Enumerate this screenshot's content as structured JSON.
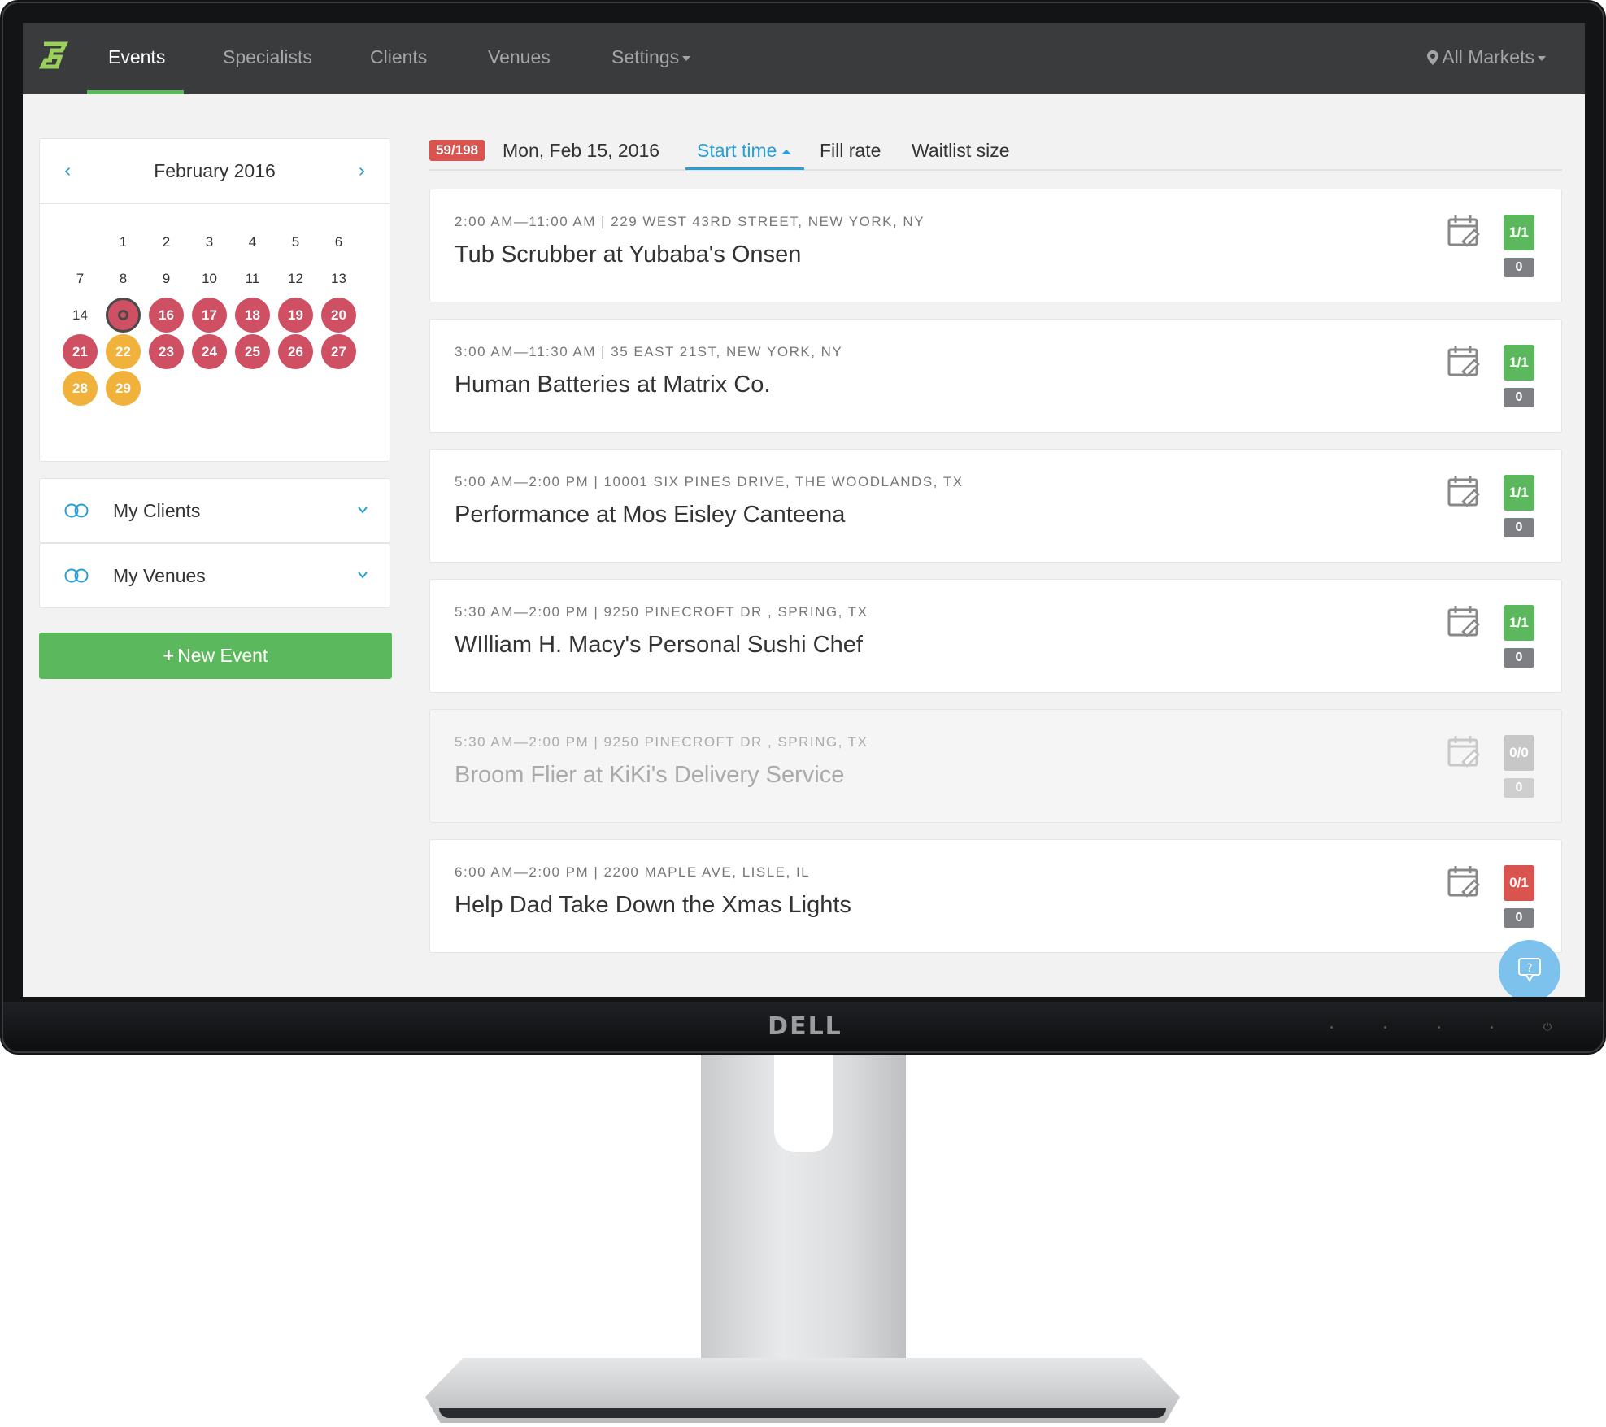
{
  "nav": {
    "items": [
      {
        "label": "Events"
      },
      {
        "label": "Specialists"
      },
      {
        "label": "Clients"
      },
      {
        "label": "Venues"
      },
      {
        "label": "Settings"
      }
    ],
    "markets_label": "All Markets"
  },
  "calendar": {
    "title": "February 2016",
    "today": 15,
    "days": [
      {
        "n": "1",
        "s": "plain"
      },
      {
        "n": "2",
        "s": "plain"
      },
      {
        "n": "3",
        "s": "plain"
      },
      {
        "n": "4",
        "s": "plain"
      },
      {
        "n": "5",
        "s": "plain"
      },
      {
        "n": "6",
        "s": "plain"
      },
      {
        "n": "7",
        "s": "plain"
      },
      {
        "n": "8",
        "s": "plain"
      },
      {
        "n": "9",
        "s": "plain"
      },
      {
        "n": "10",
        "s": "plain"
      },
      {
        "n": "11",
        "s": "plain"
      },
      {
        "n": "12",
        "s": "plain"
      },
      {
        "n": "13",
        "s": "plain"
      },
      {
        "n": "14",
        "s": "plain"
      },
      {
        "n": "15",
        "s": "today"
      },
      {
        "n": "16",
        "s": "red"
      },
      {
        "n": "17",
        "s": "red"
      },
      {
        "n": "18",
        "s": "red"
      },
      {
        "n": "19",
        "s": "red"
      },
      {
        "n": "20",
        "s": "red"
      },
      {
        "n": "21",
        "s": "red"
      },
      {
        "n": "22",
        "s": "orange"
      },
      {
        "n": "23",
        "s": "red"
      },
      {
        "n": "24",
        "s": "red"
      },
      {
        "n": "25",
        "s": "red"
      },
      {
        "n": "26",
        "s": "red"
      },
      {
        "n": "27",
        "s": "red"
      },
      {
        "n": "28",
        "s": "orange"
      },
      {
        "n": "29",
        "s": "orange"
      }
    ],
    "colors": {
      "booked": "#cf4f63",
      "partial": "#f0b23a"
    }
  },
  "filters": {
    "clients_label": "My Clients",
    "venues_label": "My Venues"
  },
  "new_event_label": "New Event",
  "list": {
    "count_badge": "59/198",
    "date": "Mon, Feb 15, 2016",
    "sort_tabs": [
      "Start time",
      "Fill rate",
      "Waitlist size"
    ]
  },
  "events": [
    {
      "meta": "2:00 AM—11:00 AM | 229 WEST 43RD STREET, NEW YORK, NY",
      "title": "Tub Scrubber at Yubaba's Onsen",
      "fill": "1/1",
      "waitlist": "0",
      "status": "green"
    },
    {
      "meta": "3:00 AM—11:30 AM | 35 EAST 21ST, NEW YORK, NY",
      "title": "Human Batteries at Matrix Co.",
      "fill": "1/1",
      "waitlist": "0",
      "status": "green"
    },
    {
      "meta": "5:00 AM—2:00 PM | 10001 SIX PINES DRIVE, THE WOODLANDS, TX",
      "title": "Performance at Mos Eisley Canteena",
      "fill": "1/1",
      "waitlist": "0",
      "status": "green"
    },
    {
      "meta": "5:30 AM—2:00 PM | 9250 PINECROFT DR , SPRING, TX",
      "title": "WIlliam H. Macy's Personal Sushi Chef",
      "fill": "1/1",
      "waitlist": "0",
      "status": "green"
    },
    {
      "meta": "5:30 AM—2:00 PM | 9250 PINECROFT DR , SPRING, TX",
      "title": "Broom Flier at KiKi's Delivery Service",
      "fill": "0/0",
      "waitlist": "0",
      "status": "grey"
    },
    {
      "meta": "6:00 AM—2:00 PM | 2200 MAPLE AVE, LISLE, IL",
      "title": "Help Dad Take Down the Xmas Lights",
      "fill": "0/1",
      "waitlist": "0",
      "status": "red"
    }
  ],
  "monitor": {
    "brand": "DELL"
  },
  "theme": {
    "nav_bg": "#393b3d",
    "accent_green": "#5cb85c",
    "accent_blue": "#2a9fd6",
    "danger": "#d9534f"
  }
}
